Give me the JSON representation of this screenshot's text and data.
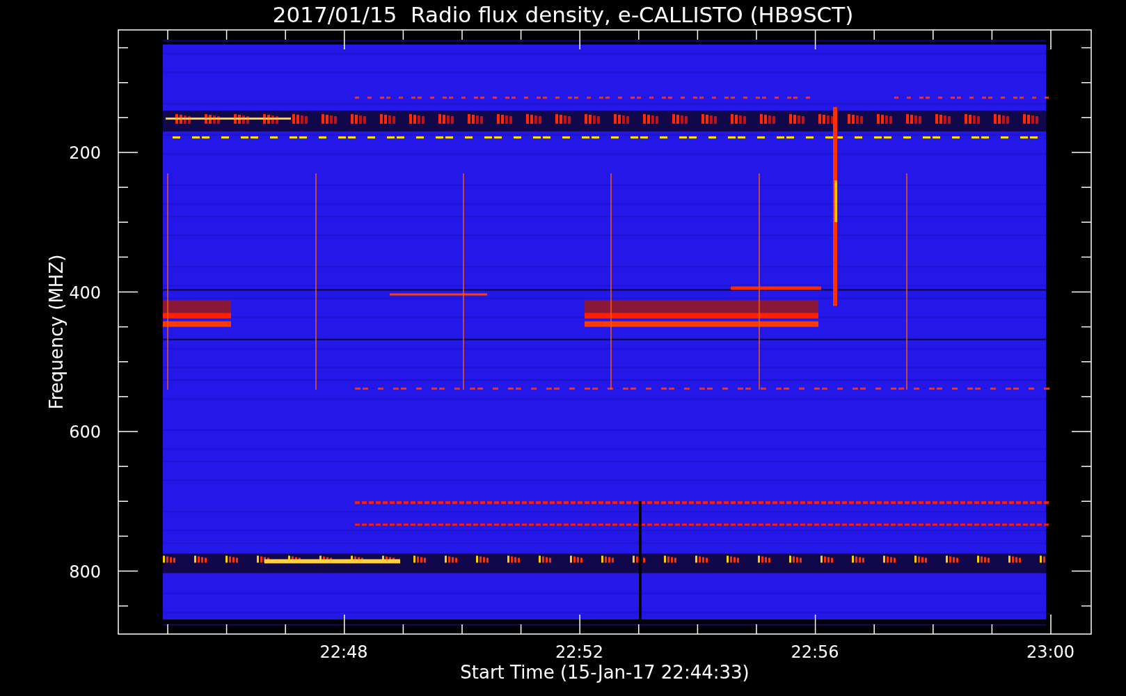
{
  "title": "2017/01/15  Radio flux density, e-CALLISTO (HB9SCT)",
  "y_axis": {
    "label": "Frequency (MHZ)",
    "ticks": [
      "200",
      "400",
      "600",
      "800"
    ]
  },
  "x_axis": {
    "label": "Start Time (15-Jan-17 22:44:33)",
    "ticks": [
      "22:48",
      "22:52",
      "22:56",
      "23:00"
    ]
  }
}
